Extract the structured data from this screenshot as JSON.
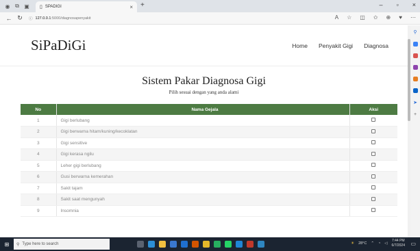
{
  "browser": {
    "tab_title": "SPADIGI",
    "tab_close": "×",
    "new_tab": "+",
    "url_host": "127.0.0.1",
    "url_path": ":5000/diagnosapenyakit",
    "window_controls": [
      "–",
      "▫",
      "×"
    ]
  },
  "site": {
    "brand": "SiPaDiGi",
    "menu": [
      "Home",
      "Penyakit Gigi",
      "Diagnosa"
    ]
  },
  "header": {
    "title": "Sistem Pakar Diagnosa Gigi",
    "subtitle": "Pilih sesuai dengan yang anda alami"
  },
  "table": {
    "columns": [
      "No",
      "Nama Gejala",
      "Aksi"
    ],
    "rows": [
      {
        "no": "1",
        "name": "Gigi berlubang"
      },
      {
        "no": "2",
        "name": "Gigi berwarna hitam/kuning/kecoklatan"
      },
      {
        "no": "3",
        "name": "Gigi sensitive"
      },
      {
        "no": "4",
        "name": "Gigi kerasa ngilu"
      },
      {
        "no": "5",
        "name": "Leher gigi berlubang"
      },
      {
        "no": "6",
        "name": "Gusi berwarna kemerahan"
      },
      {
        "no": "7",
        "name": "Sakit tajam"
      },
      {
        "no": "8",
        "name": "Sakit saat mengunyah"
      },
      {
        "no": "9",
        "name": "Insomnia"
      }
    ]
  },
  "taskbar": {
    "search_placeholder": "Type here to search",
    "weather": "28°C",
    "time": "7:44 PM",
    "date": "6/7/2024"
  },
  "colors": {
    "table_header": "#4d7b43",
    "taskbar": "#1b2431"
  }
}
